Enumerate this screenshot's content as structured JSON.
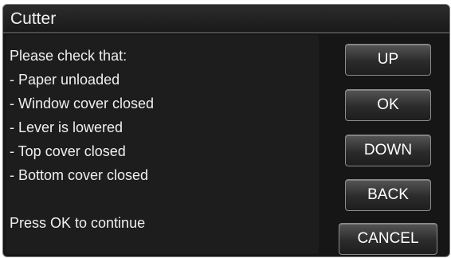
{
  "window": {
    "title": "Cutter"
  },
  "message": {
    "intro": "Please check that:",
    "checklist": [
      " - Paper unloaded",
      " - Window cover closed",
      " - Lever is lowered",
      " - Top cover closed",
      " - Bottom cover closed"
    ],
    "prompt": "Press OK to continue"
  },
  "buttons": {
    "up": "UP",
    "ok": "OK",
    "down": "DOWN",
    "back": "BACK",
    "cancel": "CANCEL"
  },
  "colors": {
    "screen_background": "#161616",
    "text": "#f0f0f0",
    "button_border": "#8c8c8c"
  }
}
